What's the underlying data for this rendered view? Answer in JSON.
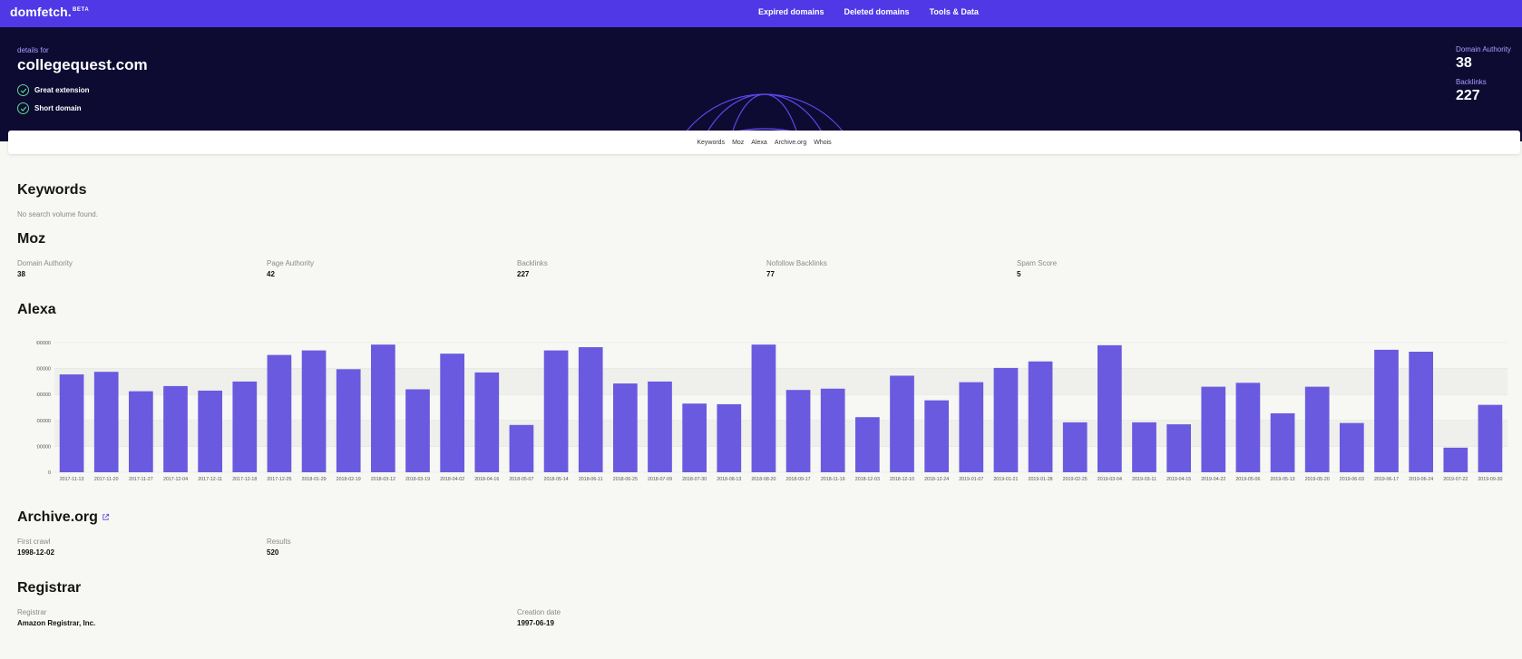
{
  "brand": {
    "logo": "domfetch.",
    "badge": "BETA"
  },
  "nav": {
    "links": [
      "Expired domains",
      "Deleted domains",
      "Tools & Data"
    ]
  },
  "hero": {
    "details_for": "details for",
    "domain": "collegequest.com",
    "features": [
      "Great extension",
      "Short domain"
    ],
    "stats": [
      {
        "label": "Domain Authority",
        "value": "38"
      },
      {
        "label": "Backlinks",
        "value": "227"
      }
    ]
  },
  "subnav": {
    "links": [
      "Keywords",
      "Moz",
      "Alexa",
      "Archive.org",
      "Whois"
    ]
  },
  "keywords": {
    "title": "Keywords",
    "empty": "No search volume found."
  },
  "moz": {
    "title": "Moz",
    "metrics": [
      {
        "label": "Domain Authority",
        "value": "38"
      },
      {
        "label": "Page Authority",
        "value": "42"
      },
      {
        "label": "Backlinks",
        "value": "227"
      },
      {
        "label": "Nofollow Backlinks",
        "value": "77"
      },
      {
        "label": "Spam Score",
        "value": "5"
      }
    ]
  },
  "alexa": {
    "title": "Alexa"
  },
  "archive": {
    "title": "Archive.org",
    "metrics": [
      {
        "label": "First crawl",
        "value": "1998-12-02"
      },
      {
        "label": "Results",
        "value": "520"
      }
    ]
  },
  "registrar": {
    "title": "Registrar",
    "metrics": [
      {
        "label": "Registrar",
        "value": "Amazon Registrar, Inc."
      },
      {
        "label": "Creation date",
        "value": "1997-06-19"
      }
    ]
  },
  "colors": {
    "brand": "#5038e6",
    "hero_bg": "#0e0b33",
    "bar": "#6a5ae0",
    "accent_text": "#a99cff",
    "check": "#5dd68a"
  },
  "icons": {
    "check": "check-circle-icon",
    "external": "external-link-icon"
  },
  "chart_data": {
    "type": "bar",
    "categories": [
      "2017-11-13",
      "2017-11-20",
      "2017-11-27",
      "2017-12-04",
      "2017-12-11",
      "2017-12-18",
      "2017-12-25",
      "2018-01-29",
      "2018-02-19",
      "2018-03-12",
      "2018-03-19",
      "2018-04-02",
      "2018-04-16",
      "2018-05-07",
      "2018-05-14",
      "2018-06-11",
      "2018-06-25",
      "2018-07-09",
      "2018-07-30",
      "2018-08-13",
      "2018-08-20",
      "2018-09-17",
      "2018-11-19",
      "2018-12-03",
      "2018-12-10",
      "2018-12-24",
      "2019-01-07",
      "2019-01-21",
      "2019-01-28",
      "2019-02-25",
      "2019-03-04",
      "2019-03-11",
      "2019-04-15",
      "2019-04-22",
      "2019-05-06",
      "2019-05-13",
      "2019-05-20",
      "2019-06-03",
      "2019-06-17",
      "2019-06-24",
      "2019-07-22",
      "2019-09-30"
    ],
    "values": [
      755000,
      775000,
      625000,
      665000,
      630000,
      700000,
      905000,
      940000,
      795000,
      985000,
      640000,
      915000,
      770000,
      365000,
      940000,
      965000,
      685000,
      700000,
      530000,
      525000,
      985000,
      635000,
      645000,
      425000,
      745000,
      555000,
      695000,
      805000,
      855000,
      385000,
      980000,
      385000,
      370000,
      660000,
      690000,
      455000,
      660000,
      380000,
      945000,
      930000,
      190000,
      520000
    ],
    "yticks": [
      "0",
      "200000",
      "400000",
      "600000",
      "800000",
      "1000000"
    ],
    "ylim": [
      0,
      1000000
    ],
    "grid": true
  }
}
